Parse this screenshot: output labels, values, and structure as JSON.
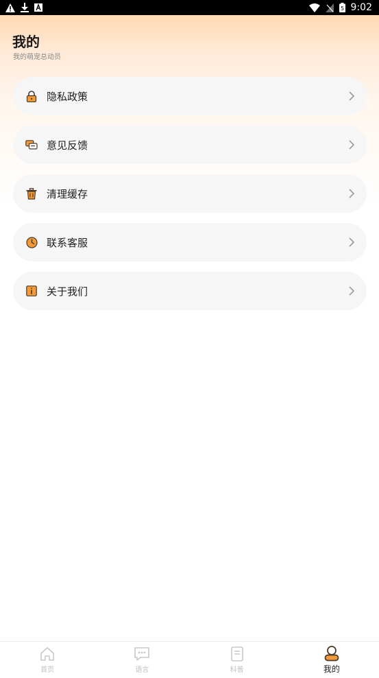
{
  "status_bar": {
    "time": "9:02",
    "battery_level": "5"
  },
  "header": {
    "title": "我的",
    "subtitle": "我的萌宠总动员"
  },
  "menu": {
    "items": [
      {
        "label": "隐私政策",
        "icon": "lock-icon"
      },
      {
        "label": "意见反馈",
        "icon": "feedback-icon"
      },
      {
        "label": "清理缓存",
        "icon": "trash-icon"
      },
      {
        "label": "联系客服",
        "icon": "service-icon"
      },
      {
        "label": "关于我们",
        "icon": "info-icon"
      }
    ]
  },
  "tabbar": {
    "tabs": [
      {
        "label": "首页",
        "icon": "home-icon",
        "active": false
      },
      {
        "label": "语言",
        "icon": "chat-icon",
        "active": false
      },
      {
        "label": "科普",
        "icon": "document-icon",
        "active": false
      },
      {
        "label": "我的",
        "icon": "person-icon",
        "active": true
      }
    ]
  },
  "colors": {
    "accent": "#F29A38",
    "icon_dark": "#4a3a2a",
    "inactive": "#c2c2c2"
  }
}
